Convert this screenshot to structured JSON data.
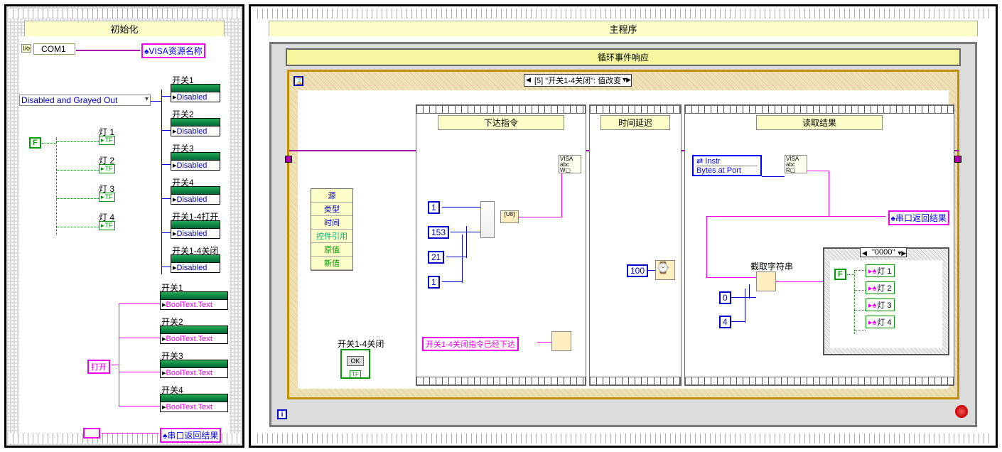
{
  "init_panel": {
    "title": "初始化",
    "com_port": "COM1",
    "visa_ref": "VISA资源名称",
    "disabled_ring": "Disabled and Grayed Out",
    "lights": [
      "灯 1",
      "灯 2",
      "灯 3",
      "灯 4"
    ],
    "switches_disabled": [
      "开关1",
      "开关2",
      "开关3",
      "开关4",
      "开关1-4打开",
      "开关1-4关闭"
    ],
    "disabled_text": "Disabled",
    "switches_text": [
      "开关1",
      "开关2",
      "开关3",
      "开关4"
    ],
    "booltext": "BoolText.Text",
    "open_str": "打开",
    "empty_str": "",
    "return_label": "串口返回结果",
    "false_const": "F"
  },
  "main_panel": {
    "title": "主程序",
    "loop_label": "循环事件响应",
    "event_case": "[5] \"开关1-4关闭\": 值改变",
    "event_fields": [
      "源",
      "类型",
      "时间",
      "控件引用",
      "原值",
      "新值"
    ],
    "seq1": {
      "title": "下达指令",
      "cmd_bytes": [
        "1",
        "153",
        "21",
        "1"
      ],
      "sent_msg": "开关1-4关闭指令已经下达",
      "ctrl_label": "开关1-4关闭"
    },
    "seq2": {
      "title": "时间延迟",
      "delay": "100"
    },
    "seq3": {
      "title": "读取结果",
      "instr_label": "Instr",
      "bytes_label": "Bytes at Port",
      "return_out": "串口返回结果",
      "substr_label": "截取字符串",
      "substr_start": "0",
      "substr_len": "4",
      "case_default": "\"0000\"",
      "false_const": "F",
      "lights_out": [
        "灯 1",
        "灯 2",
        "灯 3",
        "灯 4"
      ]
    }
  }
}
